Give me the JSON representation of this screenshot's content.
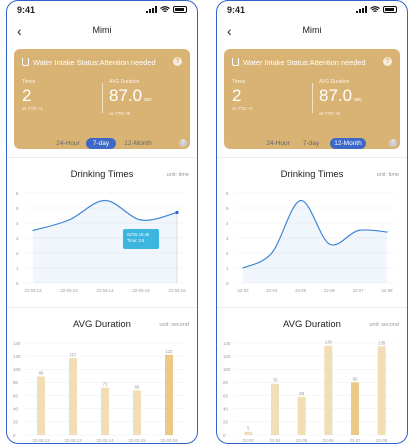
{
  "status_bar": {
    "time": "9:41"
  },
  "nav": {
    "back_icon": "chevron-left-icon",
    "title": "Mimi"
  },
  "card": {
    "cup_icon": "cup-icon",
    "title": "Water Intake Status:Attention needed",
    "info_icon": "info-icon",
    "times_label": "Times",
    "times_value": "2",
    "times_sub": "vs YTD +1",
    "avg_label": "AVG Duration",
    "avg_value": "87.0",
    "avg_unit": "sec",
    "avg_sub": "vs YTD +5"
  },
  "segments": {
    "options": [
      "24-Hour",
      "7-day",
      "12-Month"
    ]
  },
  "colors": {
    "card": "#d9b374",
    "accent": "#3d68c7",
    "line": "#3f86d4",
    "bar": "#f1ddb6",
    "bar_highlight": "#ebc886",
    "tooltip": "#3cb6e0"
  },
  "screens": [
    {
      "selected_segment": "7-day",
      "drinking": {
        "title": "Drinking Times",
        "unit": "unit: time",
        "tooltip": {
          "line1": "02/15 15:45",
          "line2": "Time: 3.6"
        }
      },
      "duration": {
        "title": "AVG Duration",
        "unit": "unit: second"
      }
    },
    {
      "selected_segment": "12-Month",
      "drinking": {
        "title": "Drinking Times",
        "unit": "unit: time"
      },
      "duration": {
        "title": "AVG Duration",
        "unit": "unit: second"
      }
    }
  ],
  "chart_data": [
    {
      "type": "line",
      "screen": "left",
      "title": "Drinking Times",
      "ylabel": "unit: time",
      "ylim": [
        0,
        6
      ],
      "yticks": [
        0,
        1,
        2,
        3,
        4,
        5,
        6
      ],
      "x": [
        "22-03-12",
        "22-03-13",
        "22-03-14",
        "22-03-15",
        "22-03-16"
      ],
      "values": [
        3.5,
        4.2,
        5.5,
        4.2,
        4.7
      ]
    },
    {
      "type": "bar",
      "screen": "left",
      "title": "AVG Duration",
      "ylabel": "unit: second",
      "ylim": [
        0,
        140
      ],
      "yticks": [
        0,
        20,
        40,
        60,
        80,
        100,
        120,
        140
      ],
      "categories": [
        "22-03-12",
        "22-03-13",
        "22-03-14",
        "22-03-15",
        "22-03-16"
      ],
      "values": [
        89,
        117,
        72,
        68,
        122
      ],
      "highlight": 4
    },
    {
      "type": "line",
      "screen": "right",
      "title": "Drinking Times",
      "ylabel": "unit: time",
      "ylim": [
        0,
        6
      ],
      "yticks": [
        0,
        1,
        2,
        3,
        4,
        5,
        6
      ],
      "x": [
        "22-03",
        "22-04",
        "22-05",
        "22-06",
        "22-07",
        "22-08"
      ],
      "values": [
        1.0,
        2.0,
        5.5,
        2.6,
        3.5,
        3.4
      ]
    },
    {
      "type": "bar",
      "screen": "right",
      "title": "AVG Duration",
      "ylabel": "unit: second",
      "ylim": [
        0,
        140
      ],
      "yticks": [
        0,
        20,
        40,
        60,
        80,
        100,
        120,
        140
      ],
      "categories": [
        "22-03",
        "22-04",
        "22-05",
        "22-06",
        "22-07",
        "22-08"
      ],
      "values": [
        5,
        78,
        58,
        136,
        80,
        135
      ],
      "highlight": 4
    }
  ]
}
